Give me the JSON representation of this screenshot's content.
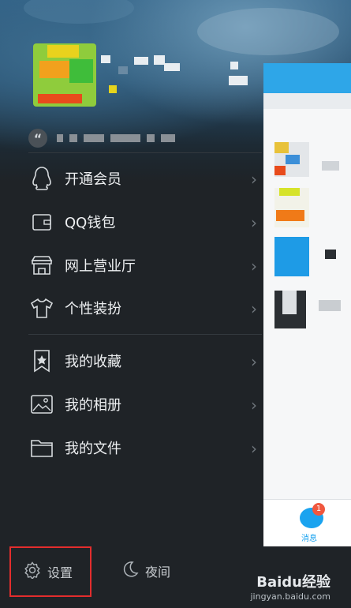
{
  "signature": {
    "quote_glyph": "“"
  },
  "menu": {
    "items": [
      {
        "label": "开通会员",
        "icon": "penguin-icon"
      },
      {
        "label": "QQ钱包",
        "icon": "wallet-icon"
      },
      {
        "label": "网上营业厅",
        "icon": "store-icon"
      },
      {
        "label": "个性装扮",
        "icon": "tshirt-icon"
      },
      {
        "label": "我的收藏",
        "icon": "bookmark-star-icon"
      },
      {
        "label": "我的相册",
        "icon": "photo-icon"
      },
      {
        "label": "我的文件",
        "icon": "folder-icon"
      }
    ]
  },
  "right_panel": {
    "tab_label": "消息",
    "badge_count": "1"
  },
  "bottom": {
    "settings_label": "设置",
    "night_label": "夜间"
  },
  "watermark": {
    "logo": "Baidu经验",
    "url": "jingyan.baidu.com"
  },
  "colors": {
    "accent_blue": "#1aa3ef",
    "highlight_red": "#e32d2d",
    "badge_red": "#f0573e",
    "drawer_bg": "#1f2327"
  }
}
